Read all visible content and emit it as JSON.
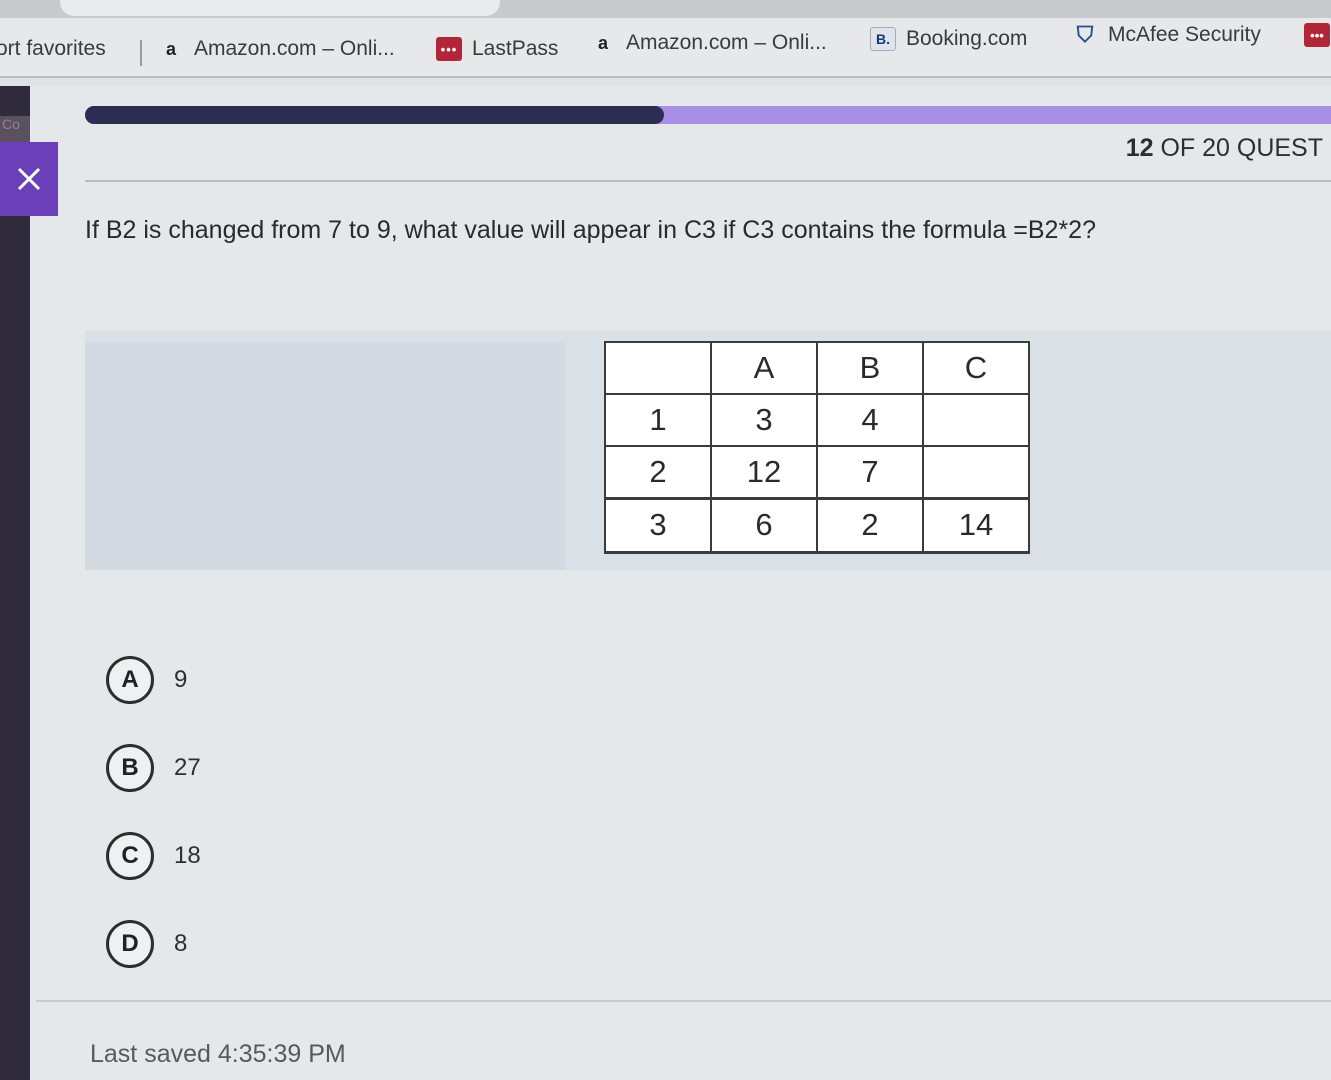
{
  "favorites_bar": {
    "items": [
      {
        "label": "ort favorites",
        "icon": "none"
      },
      {
        "label": "Amazon.com – Onli...",
        "icon": "amazon-icon"
      },
      {
        "label": "LastPass",
        "icon": "lastpass-icon"
      },
      {
        "label": "Amazon.com – Onli...",
        "icon": "amazon-icon"
      },
      {
        "label": "Booking.com",
        "icon": "booking-icon"
      },
      {
        "label": "McAfee Security",
        "icon": "mcafee-icon"
      }
    ],
    "icon_glyphs": {
      "amazon": "a",
      "lastpass": "•••",
      "booking": "B.",
      "mcafee": "⛉",
      "more": "•••"
    }
  },
  "app": {
    "rail_tag": "Co",
    "progress": {
      "current": 12,
      "total": 20,
      "fill_fraction": 0.465
    },
    "counter": {
      "number": "12",
      "rest": "OF 20 QUEST"
    },
    "question": "If B2 is changed from 7 to 9, what value will appear in C3 if C3 contains the formula =B2*2?",
    "sheet": {
      "columns": [
        "",
        "A",
        "B",
        "C"
      ],
      "rows": [
        [
          "1",
          "3",
          "4",
          ""
        ],
        [
          "2",
          "12",
          "7",
          ""
        ],
        [
          "3",
          "6",
          "2",
          "14"
        ]
      ]
    },
    "options": [
      {
        "letter": "A",
        "text": "9"
      },
      {
        "letter": "B",
        "text": "27"
      },
      {
        "letter": "C",
        "text": "18"
      },
      {
        "letter": "D",
        "text": "8"
      }
    ],
    "last_saved": "Last saved 4:35:39 PM"
  },
  "colors": {
    "accent_purple": "#6a3fb8",
    "progress_done": "#2b2e52",
    "progress_remaining": "#a98ee6",
    "lastpass_red": "#b3263a"
  }
}
